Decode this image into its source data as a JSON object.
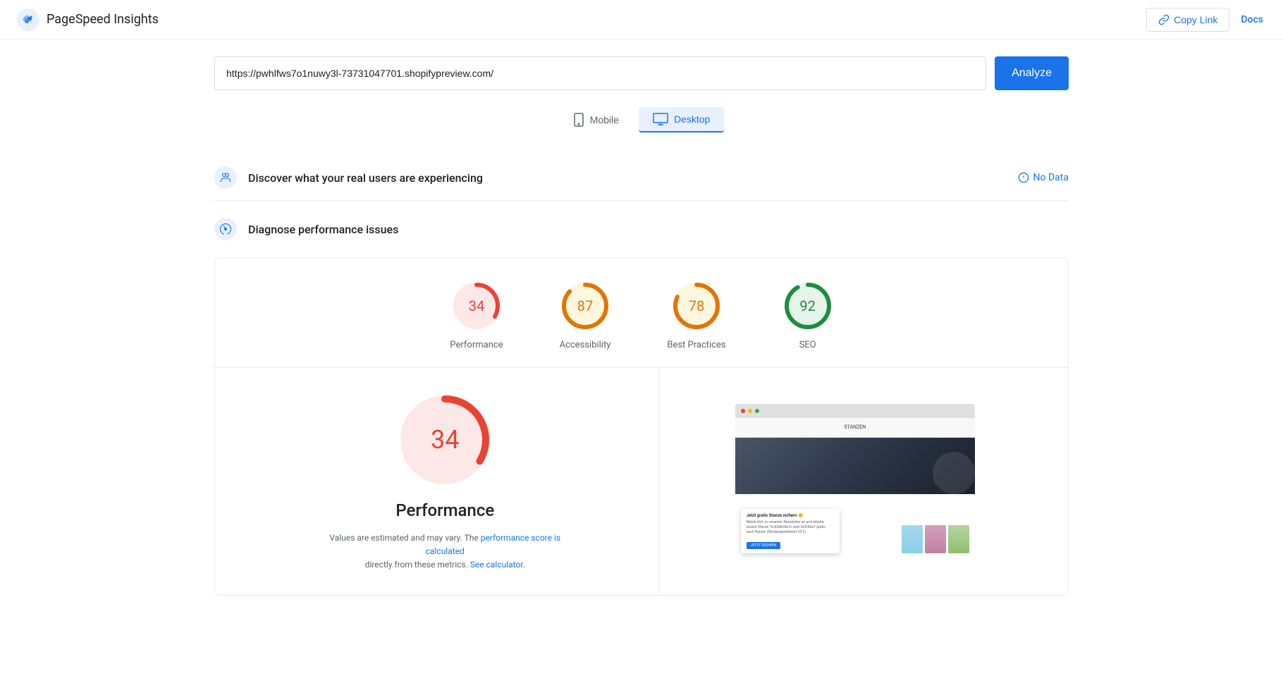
{
  "header": {
    "logo_text": "PageSpeed Insights",
    "copy_link_label": "Copy Link",
    "docs_label": "Docs"
  },
  "url_bar": {
    "url_value": "https://pwhlfws7o1nuwy3l-73731047701.shopifypreview.com/",
    "analyze_label": "Analyze"
  },
  "device_toggle": {
    "mobile_label": "Mobile",
    "desktop_label": "Desktop",
    "active": "desktop"
  },
  "discover_section": {
    "title": "Discover what your real users are experiencing",
    "no_data_label": "No Data"
  },
  "diagnose_section": {
    "title": "Diagnose performance issues"
  },
  "scores": [
    {
      "id": "performance",
      "value": 34,
      "label": "Performance",
      "color": "#ea4335",
      "bg_color": "#fce8e6",
      "track_color": "#fce8e6",
      "stroke_color": "#ea4335"
    },
    {
      "id": "accessibility",
      "value": 87,
      "label": "Accessibility",
      "color": "#e37400",
      "bg_color": "#fef7e0",
      "track_color": "#fef7e0",
      "stroke_color": "#e37400"
    },
    {
      "id": "best-practices",
      "value": 78,
      "label": "Best Practices",
      "color": "#e37400",
      "bg_color": "#fef7e0",
      "track_color": "#fef7e0",
      "stroke_color": "#e37400"
    },
    {
      "id": "seo",
      "value": 92,
      "label": "SEO",
      "color": "#1e8e3e",
      "bg_color": "#e6f4ea",
      "track_color": "#e6f4ea",
      "stroke_color": "#1e8e3e"
    }
  ],
  "performance_detail": {
    "score": "34",
    "title": "Performance",
    "note_prefix": "Values are estimated and may vary. The",
    "note_link1_text": "performance score is calculated",
    "note_link1_url": "#",
    "note_middle": "directly from these metrics.",
    "note_link2_text": "See calculator.",
    "note_link2_url": "#"
  }
}
